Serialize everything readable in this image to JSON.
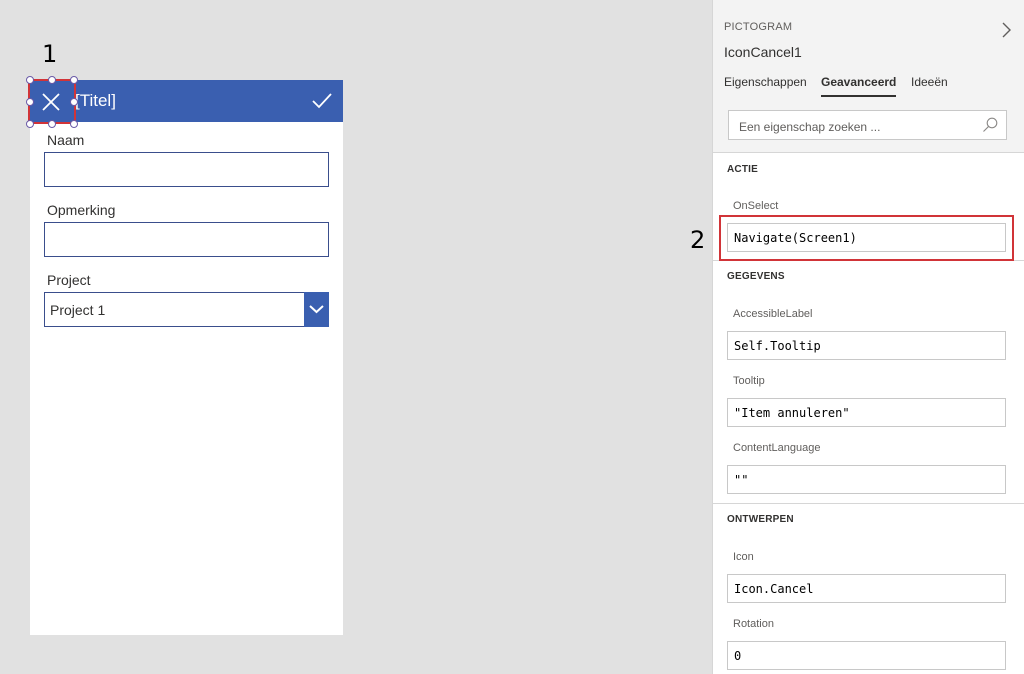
{
  "callouts": {
    "one": "1",
    "two": "2"
  },
  "app": {
    "header_title": "[Titel]",
    "fields": [
      {
        "label": "Naam",
        "value": ""
      },
      {
        "label": "Opmerking",
        "value": ""
      }
    ],
    "dropdown": {
      "label": "Project",
      "value": "Project 1"
    }
  },
  "panel": {
    "control_type": "PICTOGRAM",
    "control_name": "IconCancel1",
    "tabs": [
      "Eigenschappen",
      "Geavanceerd",
      "Ideeën"
    ],
    "active_tab": "Geavanceerd",
    "search_placeholder": "Een eigenschap zoeken ...",
    "sections": [
      {
        "title": "ACTIE",
        "properties": [
          {
            "label": "OnSelect",
            "value": "Navigate(Screen1)"
          }
        ]
      },
      {
        "title": "GEGEVENS",
        "properties": [
          {
            "label": "AccessibleLabel",
            "value": "Self.Tooltip"
          },
          {
            "label": "Tooltip",
            "value": "\"Item annuleren\""
          },
          {
            "label": "ContentLanguage",
            "value": "\"\""
          }
        ]
      },
      {
        "title": "ONTWERPEN",
        "properties": [
          {
            "label": "Icon",
            "value": "Icon.Cancel"
          },
          {
            "label": "Rotation",
            "value": "0"
          }
        ]
      }
    ]
  },
  "colors": {
    "header_blue": "#3a5fb0",
    "highlight_red": "#d13438",
    "canvas_gray": "#e1e1e1"
  },
  "icons": [
    "cancel-icon",
    "check-icon",
    "chevron-down-icon",
    "chevron-right-icon",
    "search-icon"
  ]
}
